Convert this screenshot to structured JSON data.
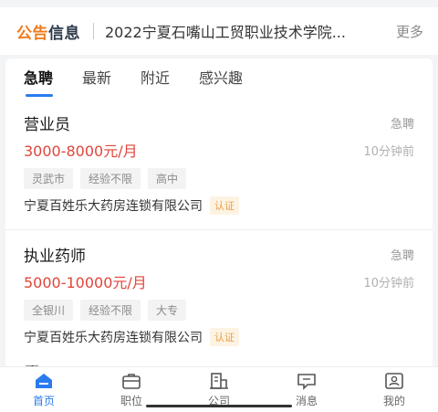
{
  "notice": {
    "logo_part1": "公告",
    "logo_part2": "信息",
    "text": "2022宁夏石嘴山工贸职业技术学院...",
    "more": "更多"
  },
  "tabs": [
    {
      "label": "急聘"
    },
    {
      "label": "最新"
    },
    {
      "label": "附近"
    },
    {
      "label": "感兴趣"
    }
  ],
  "jobs": [
    {
      "title": "营业员",
      "badge": "急聘",
      "salary": "3000-8000元/月",
      "time": "10分钟前",
      "tags": [
        "灵武市",
        "经验不限",
        "高中"
      ],
      "company": "宁夏百姓乐大药房连锁有限公司",
      "cert": "认证"
    },
    {
      "title": "执业药师",
      "badge": "急聘",
      "salary": "5000-10000元/月",
      "time": "10分钟前",
      "tags": [
        "全银川",
        "经验不限",
        "大专"
      ],
      "company": "宁夏百姓乐大药房连锁有限公司",
      "cert": "认证"
    }
  ],
  "partial_job_title": "店长",
  "nav": [
    {
      "label": "首页",
      "icon": "home-icon"
    },
    {
      "label": "职位",
      "icon": "briefcase-icon"
    },
    {
      "label": "公司",
      "icon": "building-icon"
    },
    {
      "label": "消息",
      "icon": "message-icon"
    },
    {
      "label": "我的",
      "icon": "profile-icon"
    }
  ],
  "colors": {
    "accent": "#2b7bf0",
    "salary": "#e0453b",
    "logo_orange": "#f07b1d"
  }
}
